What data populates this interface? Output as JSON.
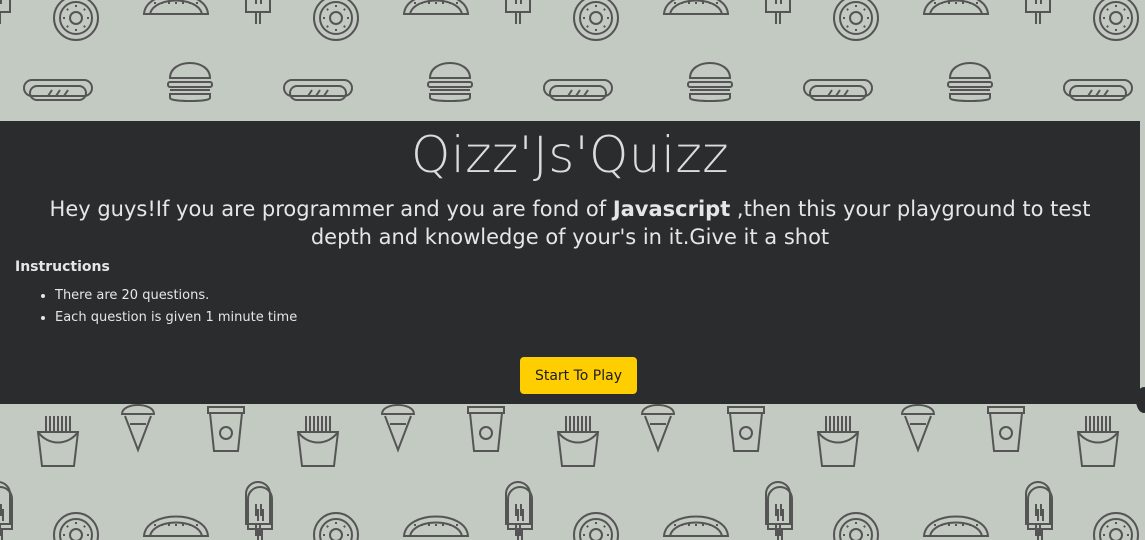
{
  "app": {
    "title": "Qizz'Js'Quizz",
    "intro_part1": "Hey guys!If you are programmer and you are fond of ",
    "intro_bold": "Javascript",
    "intro_part2": " ,then this your playground to test depth and knowledge of your's in it.Give it a shot"
  },
  "instructions": {
    "heading": "Instructions",
    "items": [
      "There are 20 questions.",
      "Each question is given 1 minute time"
    ]
  },
  "actions": {
    "start_label": "Start To Play"
  },
  "colors": {
    "background": "#c3cac2",
    "panel": "#2b2c2e",
    "accent": "#ffce00",
    "icon_stroke": "#555555"
  },
  "background_icons": [
    "donut-icon",
    "taco-icon",
    "popsicle-icon",
    "hotdog-icon",
    "burger-icon",
    "fries-icon",
    "icecream-cone-icon",
    "drink-cup-icon"
  ]
}
